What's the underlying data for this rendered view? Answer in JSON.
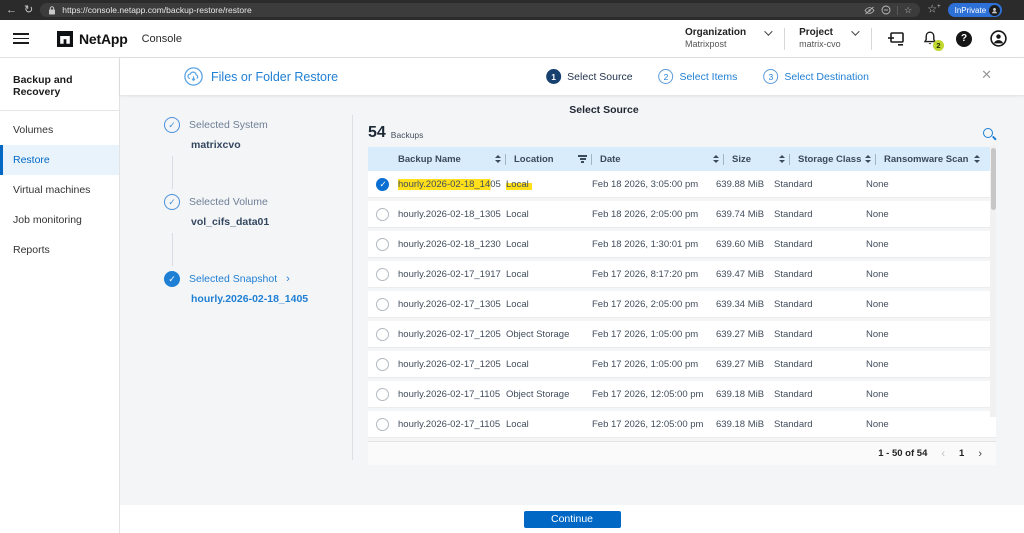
{
  "browser": {
    "url": "https://console.netapp.com/backup-restore/restore",
    "private_badge": "InPrivate"
  },
  "header": {
    "brand": "NetApp",
    "app_name": "Console",
    "organization": {
      "label": "Organization",
      "value": "Matrixpost"
    },
    "project": {
      "label": "Project",
      "value": "matrix-cvo"
    },
    "notifications_count": "2",
    "help_glyph": "?"
  },
  "sidebar": {
    "title": "Backup and Recovery",
    "items": [
      {
        "label": "Volumes"
      },
      {
        "label": "Restore",
        "active": true
      },
      {
        "label": "Virtual machines"
      },
      {
        "label": "Job monitoring"
      },
      {
        "label": "Reports"
      }
    ]
  },
  "wizard": {
    "title": "Files or Folder Restore",
    "close_glyph": "✕",
    "steps": [
      {
        "num": "1",
        "label": "Select Source",
        "current": true
      },
      {
        "num": "2",
        "label": "Select Items"
      },
      {
        "num": "3",
        "label": "Select Destination"
      }
    ]
  },
  "stepper": [
    {
      "label": "Selected System",
      "value": "matrixcvo"
    },
    {
      "label": "Selected Volume",
      "value": "vol_cifs_data01"
    },
    {
      "label": "Selected Snapshot",
      "chevron": "›",
      "value": "hourly.2026-02-18_1405",
      "filled": true,
      "last": true
    }
  ],
  "panel": {
    "section_title": "Select Source",
    "count": "54",
    "count_label": "Backups",
    "columns": [
      {
        "label": "Backup Name",
        "sort": true,
        "sep": true,
        "cls": "hc-name"
      },
      {
        "label": "Location",
        "filter": true,
        "sep": true,
        "cls": "hc-loc"
      },
      {
        "label": "Date",
        "sort": true,
        "sep": true,
        "cls": "hc-date"
      },
      {
        "label": "Size",
        "sort": true,
        "sep": true,
        "cls": "hc-size"
      },
      {
        "label": "Storage Class",
        "sort": true,
        "sep": true,
        "cls": "hc-class"
      },
      {
        "label": "Ransomware Scan",
        "sort": true,
        "cls": "hc-scan"
      }
    ],
    "rows": [
      {
        "name": "hourly.2026-02-18_1405",
        "location": "Local",
        "date": "Feb 18 2026, 3:05:00 pm",
        "size": "639.88 MiB",
        "storage_class": "Standard",
        "ransomware_scan": "None",
        "selected": true,
        "annotated": true
      },
      {
        "name": "hourly.2026-02-18_1305",
        "location": "Local",
        "date": "Feb 18 2026, 2:05:00 pm",
        "size": "639.74 MiB",
        "storage_class": "Standard",
        "ransomware_scan": "None"
      },
      {
        "name": "hourly.2026-02-18_1230",
        "location": "Local",
        "date": "Feb 18 2026, 1:30:01 pm",
        "size": "639.60 MiB",
        "storage_class": "Standard",
        "ransomware_scan": "None"
      },
      {
        "name": "hourly.2026-02-17_1917",
        "location": "Local",
        "date": "Feb 17 2026, 8:17:20 pm",
        "size": "639.47 MiB",
        "storage_class": "Standard",
        "ransomware_scan": "None"
      },
      {
        "name": "hourly.2026-02-17_1305",
        "location": "Local",
        "date": "Feb 17 2026, 2:05:00 pm",
        "size": "639.34 MiB",
        "storage_class": "Standard",
        "ransomware_scan": "None"
      },
      {
        "name": "hourly.2026-02-17_1205",
        "location": "Object Storage",
        "date": "Feb 17 2026, 1:05:00 pm",
        "size": "639.27 MiB",
        "storage_class": "Standard",
        "ransomware_scan": "None"
      },
      {
        "name": "hourly.2026-02-17_1205",
        "location": "Local",
        "date": "Feb 17 2026, 1:05:00 pm",
        "size": "639.27 MiB",
        "storage_class": "Standard",
        "ransomware_scan": "None"
      },
      {
        "name": "hourly.2026-02-17_1105",
        "location": "Object Storage",
        "date": "Feb 17 2026, 12:05:00 pm",
        "size": "639.18 MiB",
        "storage_class": "Standard",
        "ransomware_scan": "None"
      },
      {
        "name": "hourly.2026-02-17_1105",
        "location": "Local",
        "date": "Feb 17 2026, 12:05:00 pm",
        "size": "639.18 MiB",
        "storage_class": "Standard",
        "ransomware_scan": "None"
      }
    ],
    "pagination": {
      "range": "1 - 50 of 54",
      "prev": "‹",
      "page": "1",
      "next": "›"
    }
  },
  "footer": {
    "continue_label": "Continue"
  },
  "colors": {
    "brand_blue": "#0067C5",
    "accent_blue": "#1f7fd4",
    "table_header_bg": "#d9ecfb",
    "highlight_yellow": "#ffe01a",
    "notification_badge": "#c1d72f",
    "step_current_bg": "#17406f"
  }
}
